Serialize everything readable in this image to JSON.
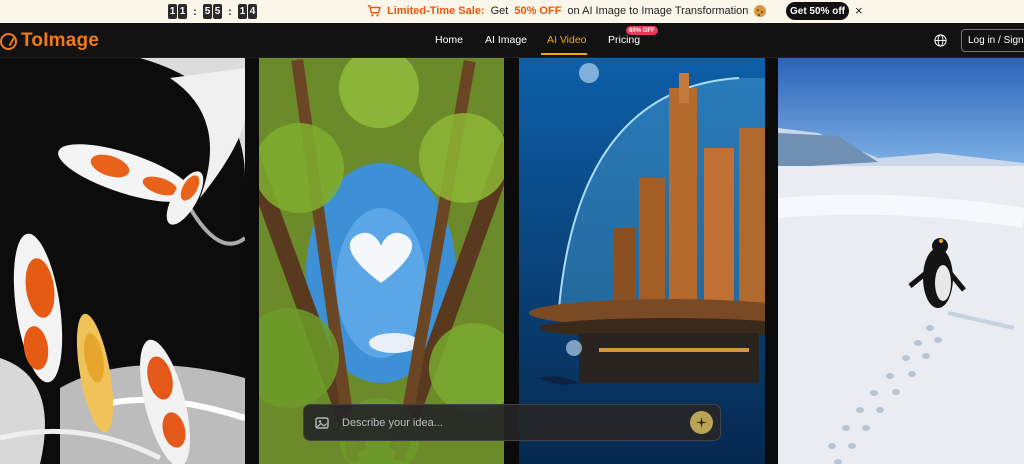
{
  "promo": {
    "countdown": {
      "h1": "1",
      "h2": "1",
      "m1": "5",
      "m2": "5",
      "s1": "1",
      "s2": "4",
      "sep": ":"
    },
    "sale_label": "Limited-Time Sale:",
    "sale_pre": "Get",
    "sale_percent": "50% OFF",
    "sale_post": "on AI Image to Image Transformation",
    "cta": "Get 50% off",
    "close": "×"
  },
  "nav": {
    "logo": "ToImage",
    "items": [
      {
        "label": "Home"
      },
      {
        "label": "AI Image"
      },
      {
        "label": "AI Video"
      },
      {
        "label": "Pricing"
      }
    ],
    "pricing_badge": "60% OFF",
    "login": "Log in / Sign Up"
  },
  "prompt": {
    "placeholder": "Describe your idea..."
  },
  "colors": {
    "accent": "#f2a51a",
    "brand": "#f07a18",
    "promo_highlight": "#e8590c"
  }
}
